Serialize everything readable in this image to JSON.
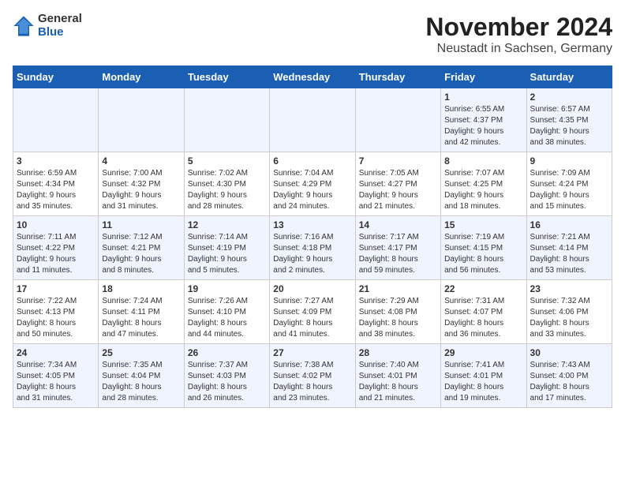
{
  "header": {
    "logo_general": "General",
    "logo_blue": "Blue",
    "title": "November 2024",
    "subtitle": "Neustadt in Sachsen, Germany"
  },
  "columns": [
    "Sunday",
    "Monday",
    "Tuesday",
    "Wednesday",
    "Thursday",
    "Friday",
    "Saturday"
  ],
  "weeks": [
    [
      {
        "day": "",
        "info": ""
      },
      {
        "day": "",
        "info": ""
      },
      {
        "day": "",
        "info": ""
      },
      {
        "day": "",
        "info": ""
      },
      {
        "day": "",
        "info": ""
      },
      {
        "day": "1",
        "info": "Sunrise: 6:55 AM\nSunset: 4:37 PM\nDaylight: 9 hours\nand 42 minutes."
      },
      {
        "day": "2",
        "info": "Sunrise: 6:57 AM\nSunset: 4:35 PM\nDaylight: 9 hours\nand 38 minutes."
      }
    ],
    [
      {
        "day": "3",
        "info": "Sunrise: 6:59 AM\nSunset: 4:34 PM\nDaylight: 9 hours\nand 35 minutes."
      },
      {
        "day": "4",
        "info": "Sunrise: 7:00 AM\nSunset: 4:32 PM\nDaylight: 9 hours\nand 31 minutes."
      },
      {
        "day": "5",
        "info": "Sunrise: 7:02 AM\nSunset: 4:30 PM\nDaylight: 9 hours\nand 28 minutes."
      },
      {
        "day": "6",
        "info": "Sunrise: 7:04 AM\nSunset: 4:29 PM\nDaylight: 9 hours\nand 24 minutes."
      },
      {
        "day": "7",
        "info": "Sunrise: 7:05 AM\nSunset: 4:27 PM\nDaylight: 9 hours\nand 21 minutes."
      },
      {
        "day": "8",
        "info": "Sunrise: 7:07 AM\nSunset: 4:25 PM\nDaylight: 9 hours\nand 18 minutes."
      },
      {
        "day": "9",
        "info": "Sunrise: 7:09 AM\nSunset: 4:24 PM\nDaylight: 9 hours\nand 15 minutes."
      }
    ],
    [
      {
        "day": "10",
        "info": "Sunrise: 7:11 AM\nSunset: 4:22 PM\nDaylight: 9 hours\nand 11 minutes."
      },
      {
        "day": "11",
        "info": "Sunrise: 7:12 AM\nSunset: 4:21 PM\nDaylight: 9 hours\nand 8 minutes."
      },
      {
        "day": "12",
        "info": "Sunrise: 7:14 AM\nSunset: 4:19 PM\nDaylight: 9 hours\nand 5 minutes."
      },
      {
        "day": "13",
        "info": "Sunrise: 7:16 AM\nSunset: 4:18 PM\nDaylight: 9 hours\nand 2 minutes."
      },
      {
        "day": "14",
        "info": "Sunrise: 7:17 AM\nSunset: 4:17 PM\nDaylight: 8 hours\nand 59 minutes."
      },
      {
        "day": "15",
        "info": "Sunrise: 7:19 AM\nSunset: 4:15 PM\nDaylight: 8 hours\nand 56 minutes."
      },
      {
        "day": "16",
        "info": "Sunrise: 7:21 AM\nSunset: 4:14 PM\nDaylight: 8 hours\nand 53 minutes."
      }
    ],
    [
      {
        "day": "17",
        "info": "Sunrise: 7:22 AM\nSunset: 4:13 PM\nDaylight: 8 hours\nand 50 minutes."
      },
      {
        "day": "18",
        "info": "Sunrise: 7:24 AM\nSunset: 4:11 PM\nDaylight: 8 hours\nand 47 minutes."
      },
      {
        "day": "19",
        "info": "Sunrise: 7:26 AM\nSunset: 4:10 PM\nDaylight: 8 hours\nand 44 minutes."
      },
      {
        "day": "20",
        "info": "Sunrise: 7:27 AM\nSunset: 4:09 PM\nDaylight: 8 hours\nand 41 minutes."
      },
      {
        "day": "21",
        "info": "Sunrise: 7:29 AM\nSunset: 4:08 PM\nDaylight: 8 hours\nand 38 minutes."
      },
      {
        "day": "22",
        "info": "Sunrise: 7:31 AM\nSunset: 4:07 PM\nDaylight: 8 hours\nand 36 minutes."
      },
      {
        "day": "23",
        "info": "Sunrise: 7:32 AM\nSunset: 4:06 PM\nDaylight: 8 hours\nand 33 minutes."
      }
    ],
    [
      {
        "day": "24",
        "info": "Sunrise: 7:34 AM\nSunset: 4:05 PM\nDaylight: 8 hours\nand 31 minutes."
      },
      {
        "day": "25",
        "info": "Sunrise: 7:35 AM\nSunset: 4:04 PM\nDaylight: 8 hours\nand 28 minutes."
      },
      {
        "day": "26",
        "info": "Sunrise: 7:37 AM\nSunset: 4:03 PM\nDaylight: 8 hours\nand 26 minutes."
      },
      {
        "day": "27",
        "info": "Sunrise: 7:38 AM\nSunset: 4:02 PM\nDaylight: 8 hours\nand 23 minutes."
      },
      {
        "day": "28",
        "info": "Sunrise: 7:40 AM\nSunset: 4:01 PM\nDaylight: 8 hours\nand 21 minutes."
      },
      {
        "day": "29",
        "info": "Sunrise: 7:41 AM\nSunset: 4:01 PM\nDaylight: 8 hours\nand 19 minutes."
      },
      {
        "day": "30",
        "info": "Sunrise: 7:43 AM\nSunset: 4:00 PM\nDaylight: 8 hours\nand 17 minutes."
      }
    ]
  ]
}
